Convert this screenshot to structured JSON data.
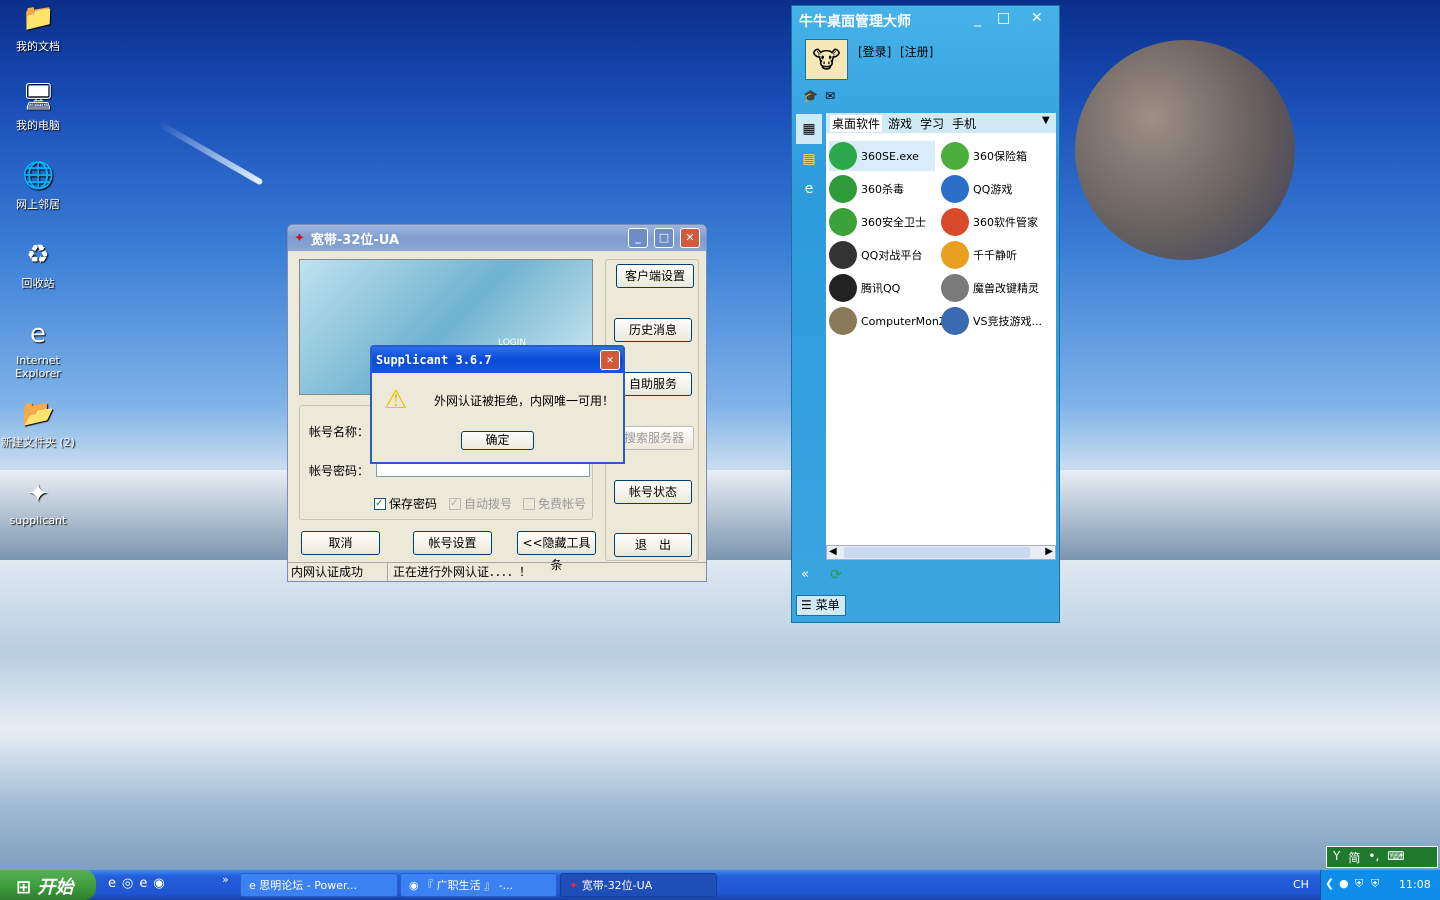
{
  "desktop": {
    "icons": [
      {
        "label": "我的文档",
        "icon": "my-documents-icon",
        "glyph": "📁"
      },
      {
        "label": "我的电脑",
        "icon": "my-computer-icon",
        "glyph": "🖥"
      },
      {
        "label": "网上邻居",
        "icon": "network-icon",
        "glyph": "🌐"
      },
      {
        "label": "回收站",
        "icon": "recycle-bin-icon",
        "glyph": "♻"
      },
      {
        "label": "Internet Explorer",
        "icon": "ie-icon",
        "glyph": "e"
      },
      {
        "label": "新建文件夹 (2)",
        "icon": "folder-icon",
        "glyph": "📂"
      },
      {
        "label": "supplicant",
        "icon": "supplicant-shortcut-icon",
        "glyph": "✦"
      }
    ]
  },
  "broadband": {
    "title": "宽带-32位-UA",
    "account_label": "帐号名称：",
    "password_label": "帐号密码：",
    "password_value": "••••••••",
    "save_password": "保存密码",
    "auto_dial": "自动拨号",
    "free_account": "免费帐号",
    "client_settings": "客户端设置",
    "history": "历史消息",
    "self_service": "自助服务",
    "search_server": "搜索服务器",
    "account_status": "帐号状态",
    "exit": "退　出",
    "cancel": "取消",
    "account_settings": "帐号设置",
    "hide_toolbar": "<<隐藏工具条",
    "status_left": "内网认证成功",
    "status_right": "正在进行外网认证．．．．！",
    "banner_text": "LOGIN"
  },
  "dialog": {
    "title": "Supplicant 3.6.7",
    "message": "外网认证被拒绝，内网唯一可用！",
    "ok": "确定"
  },
  "niuniu": {
    "title": "牛牛桌面管理大师",
    "login": "[登录]",
    "register": "[注册]",
    "tabs": [
      "桌面软件",
      "游戏",
      "学习",
      "手机"
    ],
    "apps": [
      {
        "name": "360SE.exe",
        "color": "#2aa84a"
      },
      {
        "name": "360保险箱",
        "color": "#4cae3c"
      },
      {
        "name": "360杀毒",
        "color": "#2e9a3a"
      },
      {
        "name": "QQ游戏",
        "color": "#2b6fc7"
      },
      {
        "name": "360安全卫士",
        "color": "#3ba23a"
      },
      {
        "name": "360软件管家",
        "color": "#d94a2a"
      },
      {
        "name": "QQ对战平台",
        "color": "#333333"
      },
      {
        "name": "千千静听",
        "color": "#e9a020"
      },
      {
        "name": "腾讯QQ",
        "color": "#222222"
      },
      {
        "name": "魔兽改键精灵",
        "color": "#7a7a7a"
      },
      {
        "name": "ComputerMonZ",
        "color": "#8a7a5a"
      },
      {
        "name": "VS竞技游戏...",
        "color": "#3a6ab0"
      }
    ],
    "menu": "菜单"
  },
  "taskbar": {
    "start": "开始",
    "tasks": [
      "思明论坛 - Power...",
      "『 广职生活 』 -...",
      "宽带-32位-UA"
    ],
    "lang": "CH",
    "clock": "11:08",
    "ime": "简"
  }
}
